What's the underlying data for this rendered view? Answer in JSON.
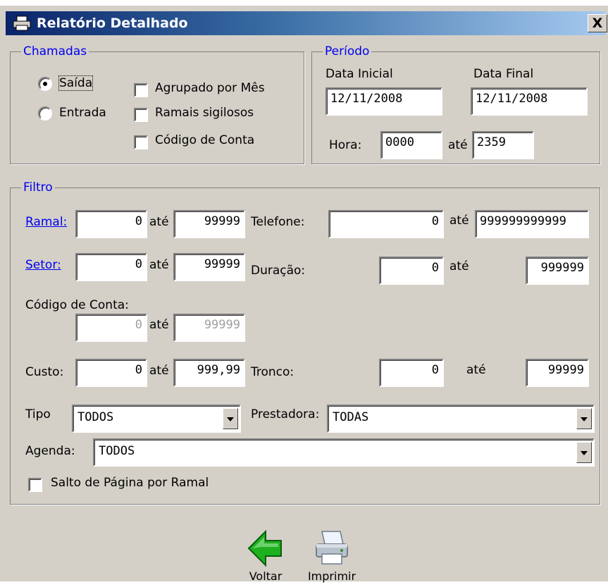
{
  "window": {
    "title": "Relatório Detalhado",
    "close_label": "X"
  },
  "chamadas": {
    "legend": "Chamadas",
    "radios": [
      {
        "label": "Saída",
        "checked": true
      },
      {
        "label": "Entrada",
        "checked": false
      }
    ],
    "checkboxes": [
      {
        "label": "Agrupado por Mês",
        "checked": false
      },
      {
        "label": "Ramais sigilosos",
        "checked": false
      },
      {
        "label": "Código de Conta",
        "checked": false
      }
    ]
  },
  "periodo": {
    "legend": "Período",
    "data_inicial_label": "Data Inicial",
    "data_inicial": "12/11/2008",
    "data_final_label": "Data Final",
    "data_final": "12/11/2008",
    "hora_label": "Hora:",
    "hora_de": "0000",
    "ate_label": "até",
    "hora_ate": "2359"
  },
  "filtro": {
    "legend": "Filtro",
    "ate": "até",
    "ramal": {
      "label": "Ramal:",
      "de": "0",
      "ate": "99999"
    },
    "setor": {
      "label": "Setor:",
      "de": "0",
      "ate": "99999"
    },
    "codigo_conta": {
      "label": "Código de Conta:",
      "de": "0",
      "ate": "99999"
    },
    "custo": {
      "label": "Custo:",
      "de": "0",
      "ate": "999,99"
    },
    "telefone": {
      "label": "Telefone:",
      "de": "0",
      "ate": "999999999999"
    },
    "duracao": {
      "label": "Duração:",
      "de": "0",
      "ate": "999999"
    },
    "tronco": {
      "label": "Tronco:",
      "de": "0",
      "ate": "99999"
    },
    "tipo": {
      "label": "Tipo",
      "value": "TODOS"
    },
    "prestadora": {
      "label": "Prestadora:",
      "value": "TODAS"
    },
    "agenda": {
      "label": "Agenda:",
      "value": "TODOS"
    },
    "salto": {
      "label": "Salto de Página por Ramal",
      "checked": false
    }
  },
  "toolbar": {
    "voltar_label": "Voltar",
    "imprimir_label": "Imprimir"
  },
  "colors": {
    "group_legend": "#0000ee",
    "face": "#d4d0c8",
    "voltar_arrow": "#1fb01f"
  }
}
